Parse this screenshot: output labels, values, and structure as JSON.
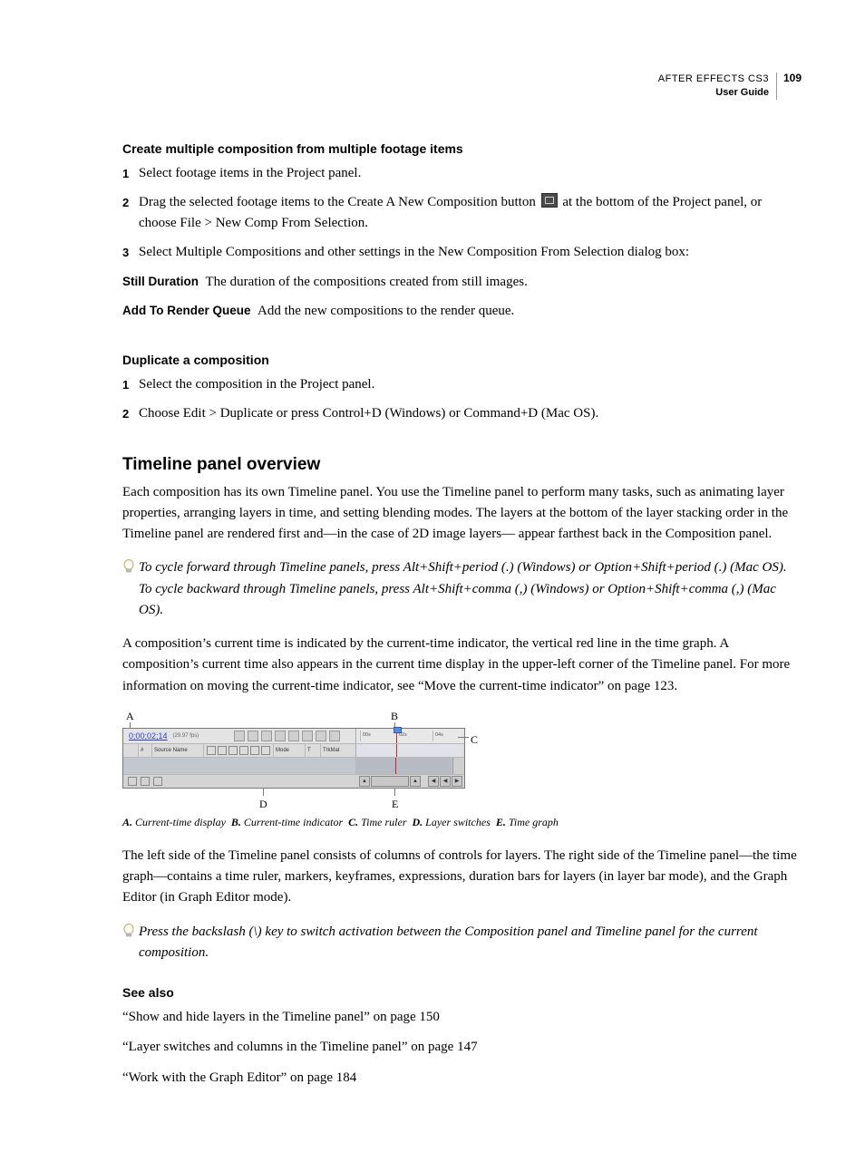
{
  "header": {
    "product": "AFTER EFFECTS CS3",
    "guide": "User Guide",
    "page": "109"
  },
  "sec1": {
    "title": "Create multiple composition from multiple footage items",
    "step1": "Select footage items in the Project panel.",
    "step2a": "Drag the selected footage items to the Create A New Composition button ",
    "step2b": " at the bottom of the Project panel, or choose File > New Comp From Selection.",
    "step3": "Select Multiple Compositions and other settings in the New Composition From Selection dialog box:",
    "defs": {
      "stillDuration": {
        "term": "Still Duration",
        "desc": "The duration of the compositions created from still images."
      },
      "addToRQ": {
        "term": "Add To Render Queue",
        "desc": "Add the new compositions to the render queue."
      }
    }
  },
  "sec2": {
    "title": "Duplicate a composition",
    "step1": "Select the composition in the Project panel.",
    "step2": "Choose Edit > Duplicate or press Control+D (Windows) or Command+D (Mac OS)."
  },
  "overview": {
    "title": "Timeline panel overview",
    "p1": "Each composition has its own Timeline panel. You use the Timeline panel to perform many tasks, such as animating layer properties, arranging layers in time, and setting blending modes. The layers at the bottom of the layer stacking order in the Timeline panel are rendered first and—in the case of 2D image layers— appear farthest back in the Composition panel.",
    "tip1": "To cycle forward through Timeline panels, press Alt+Shift+period (.) (Windows) or Option+Shift+period (.) (Mac OS). To cycle backward through Timeline panels, press Alt+Shift+comma (,) (Windows) or Option+Shift+comma (,) (Mac OS).",
    "p2": "A composition’s current time is indicated by the current-time indicator, the vertical red line in the time graph. A composition’s current time also appears in the current time display in the upper-left corner of the Timeline panel. For more information on moving the current-time indicator, see “Move the current-time indicator” on page 123.",
    "diagram": {
      "timecode": "0;00;02;14",
      "fps": "(29.97 fps)",
      "colSourceName": "Source Name",
      "colMode": "Mode",
      "colT": "T",
      "colTrkMat": "TrkMat",
      "rulerTicks": [
        "00s",
        "02s",
        "04s"
      ],
      "callouts": {
        "A": "A",
        "B": "B",
        "C": "C",
        "D": "D",
        "E": "E"
      }
    },
    "caption": {
      "A": {
        "lbl": "A.",
        "txt": "Current-time display"
      },
      "B": {
        "lbl": "B.",
        "txt": "Current-time indicator"
      },
      "C": {
        "lbl": "C.",
        "txt": "Time ruler"
      },
      "D": {
        "lbl": "D.",
        "txt": "Layer switches"
      },
      "E": {
        "lbl": "E.",
        "txt": "Time graph"
      }
    },
    "p3": "The left side of the Timeline panel consists of columns of controls for layers. The right side of the Timeline panel—the time graph—contains a time ruler, markers, keyframes, expressions, duration bars for layers (in layer bar mode), and the Graph Editor (in Graph Editor mode).",
    "tip2": "Press the backslash (\\) key to switch activation between the Composition panel and Timeline panel for the current composition."
  },
  "seealso": {
    "title": "See also",
    "links": [
      "“Show and hide layers in the Timeline panel” on page 150",
      "“Layer switches and columns in the Timeline panel” on page 147",
      "“Work with the Graph Editor” on page 184"
    ]
  }
}
